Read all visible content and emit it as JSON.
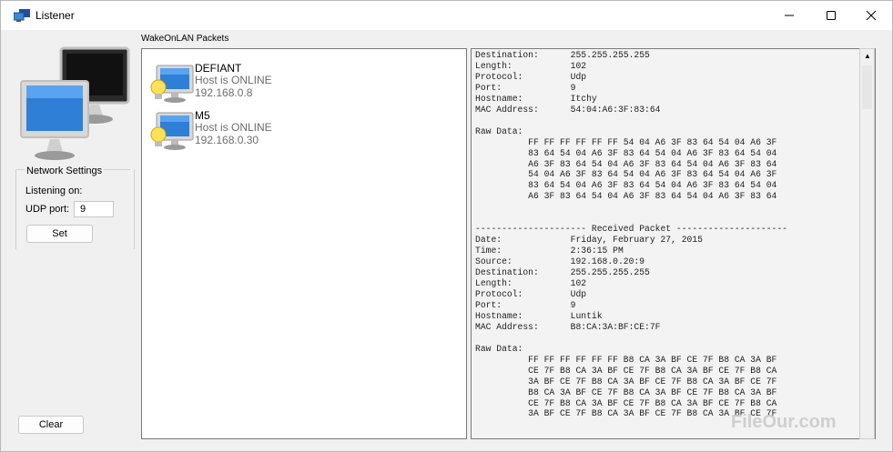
{
  "window": {
    "title": "Listener",
    "icon": "monitor-app-icon",
    "controls": [
      "minimize-icon",
      "maximize-icon",
      "close-icon"
    ]
  },
  "left_panel": {
    "image": "networked-computers-icon",
    "network_settings": {
      "title": "Network Settings",
      "listening_label": "Listening on:",
      "udp_label": "UDP port:",
      "udp_value": "9",
      "set_label": "Set"
    },
    "clear_label": "Clear"
  },
  "packets": {
    "label": "WakeOnLAN Packets",
    "hosts": [
      {
        "name": "DEFIANT",
        "status": "Host is ONLINE",
        "ip": "192.168.0.8",
        "icon": "computer-bulb-icon"
      },
      {
        "name": "M5",
        "status": "Host is ONLINE",
        "ip": "192.168.0.30",
        "icon": "computer-bulb-icon"
      }
    ]
  },
  "log": {
    "lines": [
      "Destination:      255.255.255.255",
      "Length:           102",
      "Protocol:         Udp",
      "Port:             9",
      "Hostname:         Itchy",
      "MAC Address:      54:04:A6:3F:83:64",
      "",
      "Raw Data:",
      "          FF FF FF FF FF FF 54 04 A6 3F 83 64 54 04 A6 3F",
      "          83 64 54 04 A6 3F 83 64 54 04 A6 3F 83 64 54 04",
      "          A6 3F 83 64 54 04 A6 3F 83 64 54 04 A6 3F 83 64",
      "          54 04 A6 3F 83 64 54 04 A6 3F 83 64 54 04 A6 3F",
      "          83 64 54 04 A6 3F 83 64 54 04 A6 3F 83 64 54 04",
      "          A6 3F 83 64 54 04 A6 3F 83 64 54 04 A6 3F 83 64",
      "",
      "",
      "--------------------- Received Packet ---------------------",
      "Date:             Friday, February 27, 2015",
      "Time:             2:36:15 PM",
      "Source:           192.168.0.20:9",
      "Destination:      255.255.255.255",
      "Length:           102",
      "Protocol:         Udp",
      "Port:             9",
      "Hostname:         Luntik",
      "MAC Address:      B8:CA:3A:BF:CE:7F",
      "",
      "Raw Data:",
      "          FF FF FF FF FF FF B8 CA 3A BF CE 7F B8 CA 3A BF",
      "          CE 7F B8 CA 3A BF CE 7F B8 CA 3A BF CE 7F B8 CA",
      "          3A BF CE 7F B8 CA 3A BF CE 7F B8 CA 3A BF CE 7F",
      "          B8 CA 3A BF CE 7F B8 CA 3A BF CE 7F B8 CA 3A BF",
      "          CE 7F B8 CA 3A BF CE 7F B8 CA 3A BF CE 7F B8 CA",
      "          3A BF CE 7F B8 CA 3A BF CE 7F B8 CA 3A BF CE 7F"
    ]
  },
  "watermark": "FileOur.com",
  "colors": {
    "titlebar": "#ffffff",
    "background": "#f0f0f0",
    "muted_text": "#6d6d6d",
    "monitor_blue": "#2f7fd6"
  }
}
